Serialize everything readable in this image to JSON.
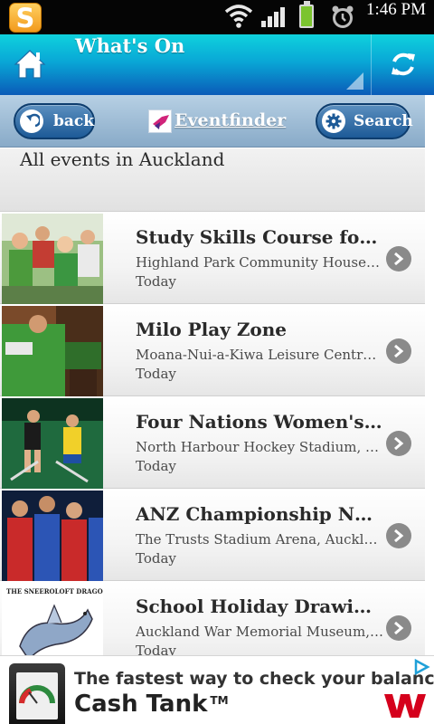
{
  "status_bar": {
    "time": "1:46 PM",
    "app_icon_letter": "S",
    "icons": [
      "wifi-icon",
      "signal-icon",
      "battery-icon",
      "alarm-icon"
    ]
  },
  "app_bar": {
    "title": "What's On",
    "home_icon": "home-icon",
    "refresh_icon": "refresh-icon",
    "accent_color": "#09a7d6"
  },
  "toolbar": {
    "back_label": "back",
    "brand_label": "Eventfinder",
    "search_label": "Search"
  },
  "section": {
    "header": "All events in Auckland"
  },
  "events": [
    {
      "title": "Study Skills Course for College Students",
      "venue": "Highland Park Community House, Auckland",
      "date": "Today"
    },
    {
      "title": "Milo Play Zone",
      "venue": "Moana-Nui-a-Kiwa Leisure Centre, Auckland",
      "date": "Today"
    },
    {
      "title": "Four Nations Women's Hockey",
      "venue": "North Harbour Hockey Stadium, Auckland",
      "date": "Today"
    },
    {
      "title": "ANZ Championship Netball",
      "venue": "The Trusts Stadium Arena, Auckland",
      "date": "Today"
    },
    {
      "title": "School Holiday Drawing Workshop",
      "venue": "Auckland War Memorial Museum, Auckland",
      "date": "Today"
    }
  ],
  "ad": {
    "line1": "The fastest way to check your balance",
    "line2": "Cash Tank",
    "tm": "TM",
    "mini_text": "THE SNEEROLOFT DRAGON",
    "brand_color": "#d5001c"
  }
}
